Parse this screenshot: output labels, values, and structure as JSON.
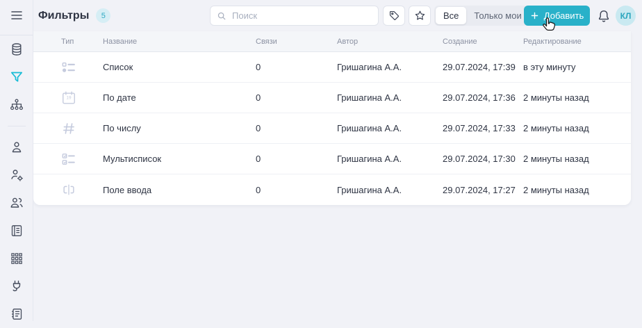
{
  "colors": {
    "accent": "#29b1c9",
    "accent_light": "#d6eef5",
    "page_bg": "#f1f2f7",
    "card_bg": "#ffffff",
    "text_dark": "#2e3443",
    "text_gray": "#8b91a2",
    "type_icon_muted": "#c5cbde",
    "sidebar_icon": "#454c5c",
    "active_sidebar_icon": "#17bcd6"
  },
  "sidebar": {
    "menu_icon": "hamburger",
    "groups": [
      [
        "database",
        "filter",
        "sitemap"
      ],
      [
        "user",
        "user-gear",
        "users",
        "journal",
        "grid",
        "plug",
        "notebook"
      ]
    ],
    "active_item": "filter"
  },
  "topbar": {
    "title": "Фильтры",
    "count_badge": "5",
    "search_placeholder": "Поиск",
    "filter_toggle": {
      "options": [
        "Все",
        "Только мои"
      ],
      "selected": "Все"
    },
    "add_button_label": "Добавить",
    "avatar_initials": "КЛ"
  },
  "table": {
    "columns": [
      "Тип",
      "Название",
      "Связи",
      "Автор",
      "Создание",
      "Редактирование"
    ],
    "rows": [
      {
        "type_icon": "list",
        "name": "Список",
        "links": "0",
        "author": "Гришагина А.А.",
        "created": "29.07.2024, 17:39",
        "edited": "в эту минуту"
      },
      {
        "type_icon": "calendar",
        "name": "По дате",
        "links": "0",
        "author": "Гришагина А.А.",
        "created": "29.07.2024, 17:36",
        "edited": "2 минуты назад"
      },
      {
        "type_icon": "number",
        "name": "По числу",
        "links": "0",
        "author": "Гришагина А.А.",
        "created": "29.07.2024, 17:33",
        "edited": "2 минуты назад"
      },
      {
        "type_icon": "multilist",
        "name": "Мультисписок",
        "links": "0",
        "author": "Гришагина А.А.",
        "created": "29.07.2024, 17:30",
        "edited": "2 минуты назад"
      },
      {
        "type_icon": "input",
        "name": "Поле ввода",
        "links": "0",
        "author": "Гришагина А.А.",
        "created": "29.07.2024, 17:27",
        "edited": "2 минуты назад"
      }
    ]
  }
}
